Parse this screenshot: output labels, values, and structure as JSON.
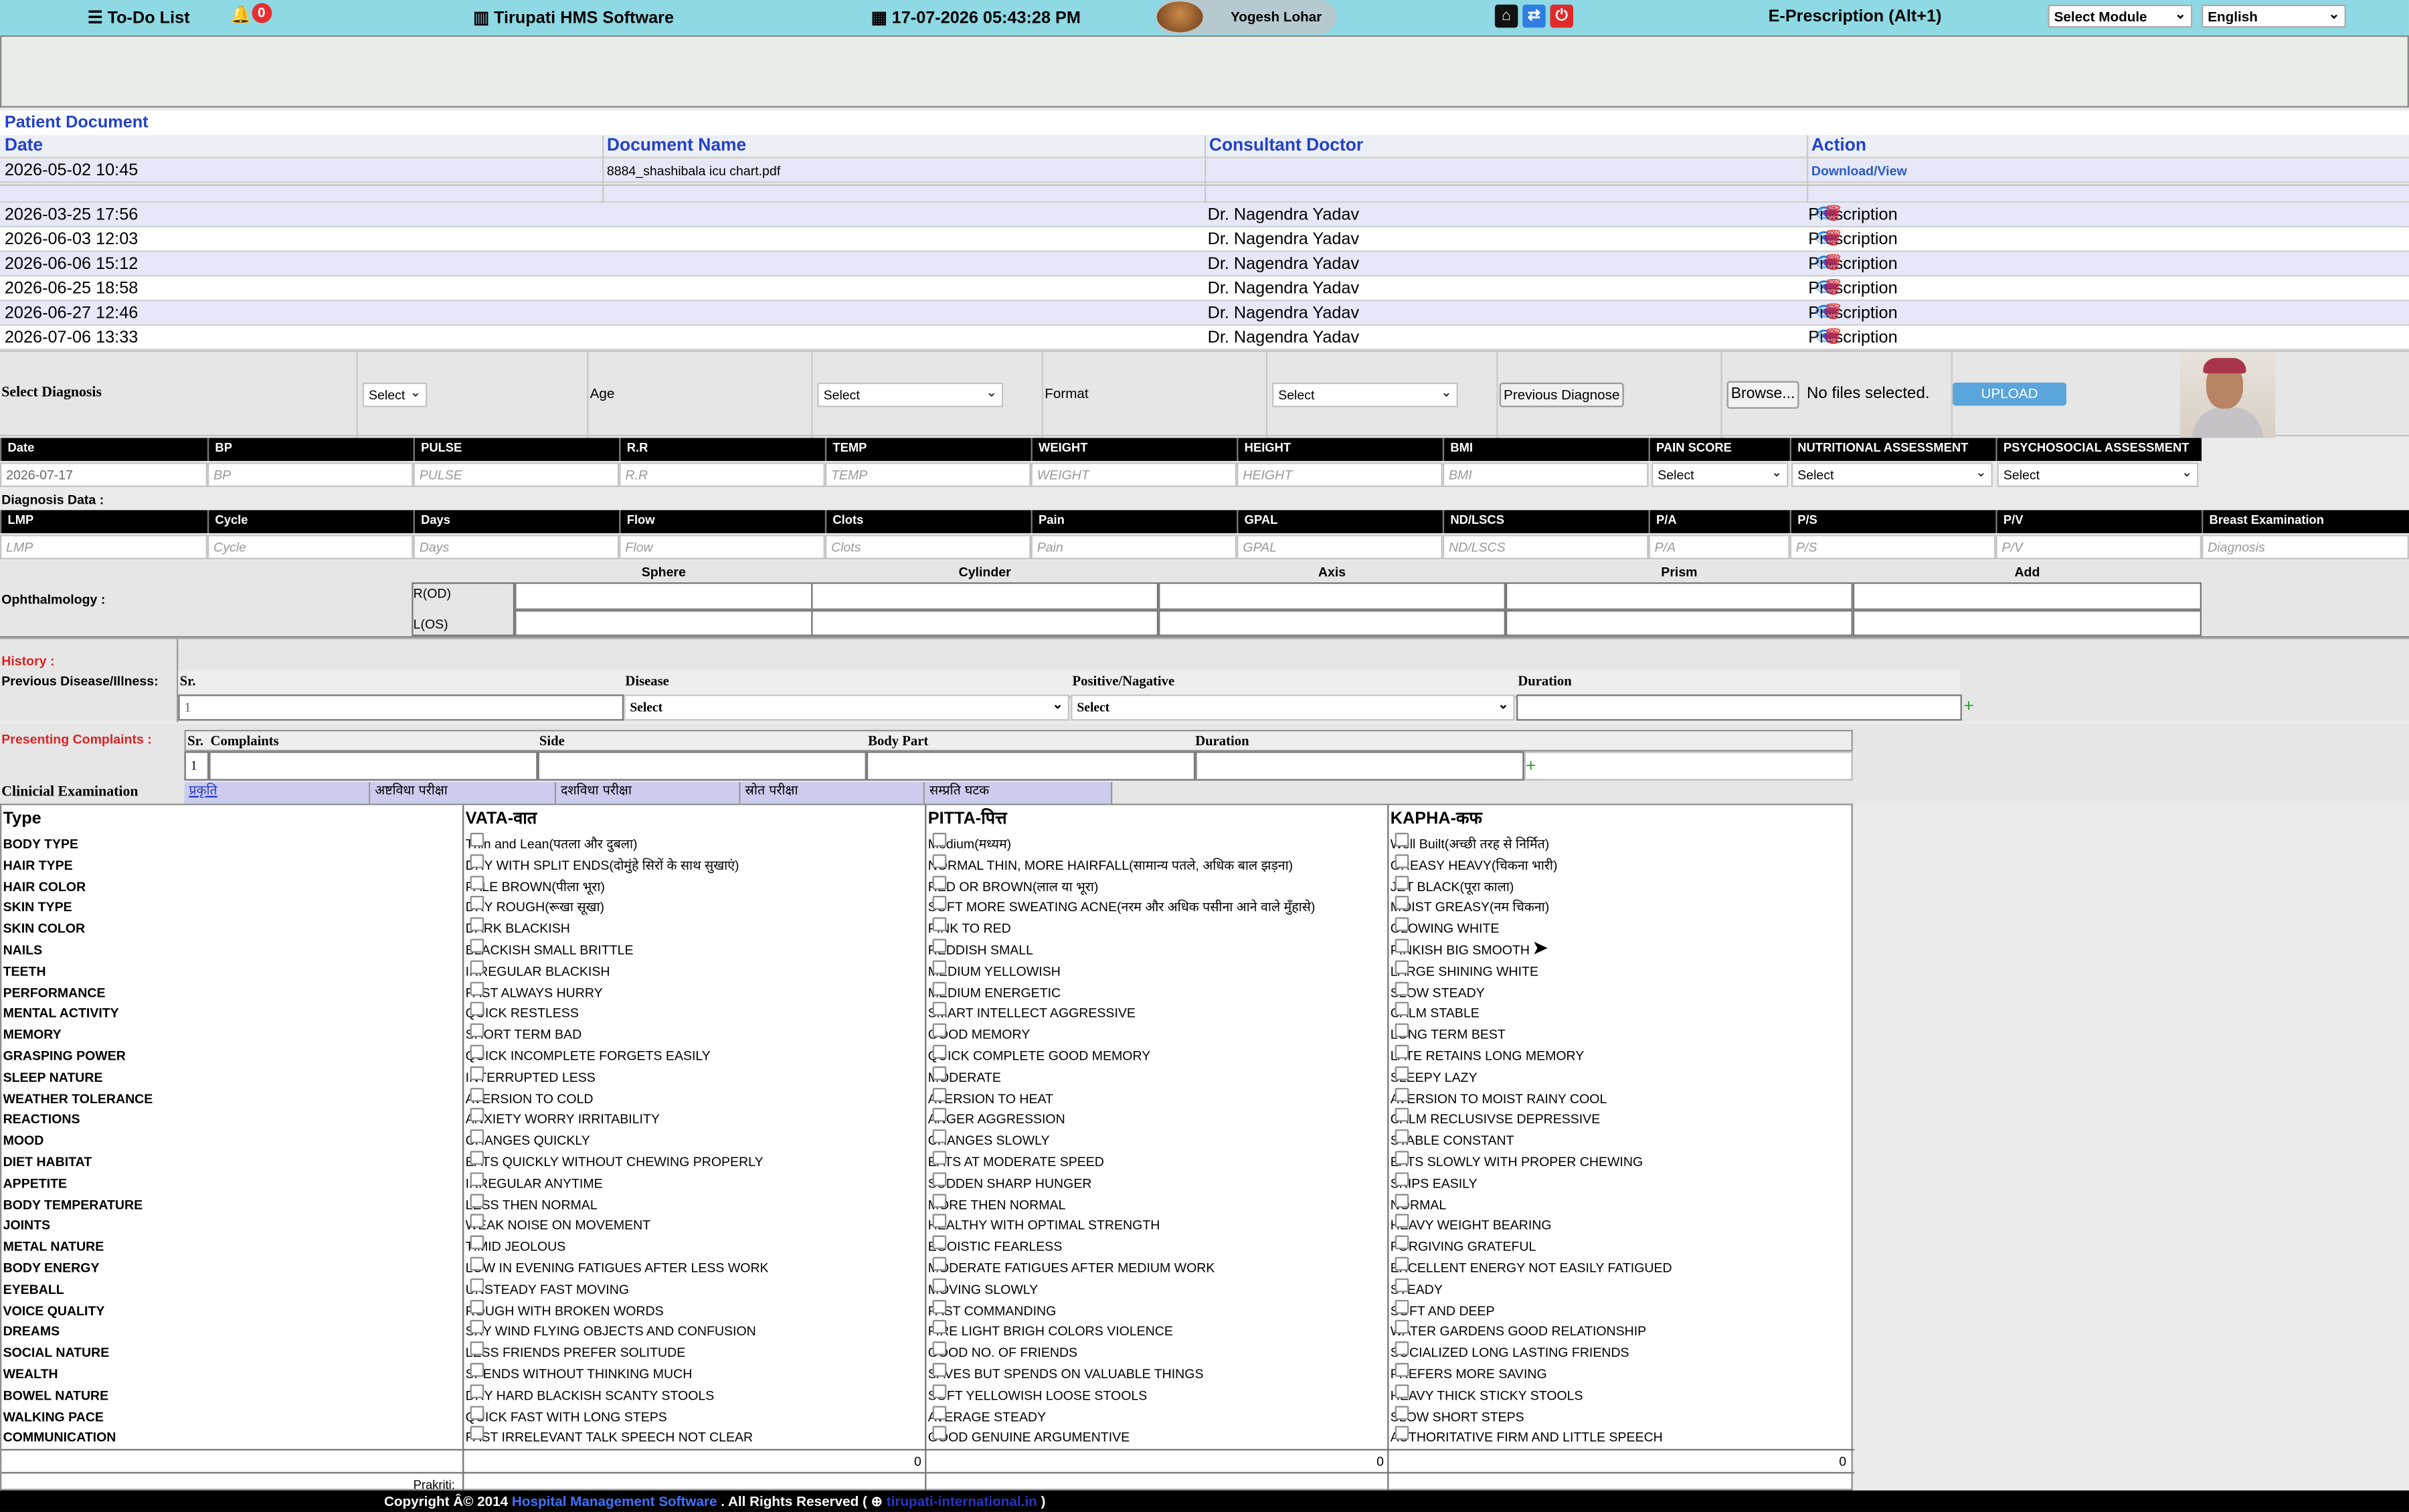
{
  "topbar": {
    "todo": "To-Do List",
    "notif_count": "0",
    "app_name": "Tirupati HMS Software",
    "datetime": "17-07-2026 05:43:28 PM",
    "user": "Yogesh Lohar",
    "eprescription": "E-Prescription (Alt+1)",
    "module_select": "Select Module",
    "language_select": "English"
  },
  "patient_document": {
    "title": "Patient Document",
    "headers": [
      "Date",
      "Document Name",
      "Consultant Doctor",
      "Action"
    ],
    "documents": [
      {
        "date": "2026-05-02 10:45",
        "name": "8884_shashibala icu chart.pdf",
        "doctor": "",
        "action": "Download/View"
      }
    ],
    "prescriptions": [
      {
        "date": "2026-03-25 17:56",
        "doctor": "Dr. Nagendra Yadav",
        "action": "Prescription"
      },
      {
        "date": "2026-06-03 12:03",
        "doctor": "Dr. Nagendra Yadav",
        "action": "Prescription"
      },
      {
        "date": "2026-06-06 15:12",
        "doctor": "Dr. Nagendra Yadav",
        "action": "Prescription"
      },
      {
        "date": "2026-06-25 18:58",
        "doctor": "Dr. Nagendra Yadav",
        "action": "Prescription"
      },
      {
        "date": "2026-06-27 12:46",
        "doctor": "Dr. Nagendra Yadav",
        "action": "Prescription"
      },
      {
        "date": "2026-07-06 13:33",
        "doctor": "Dr. Nagendra Yadav",
        "action": "Prescription"
      }
    ]
  },
  "diagnosis": {
    "select_label": "Select Diagnosis",
    "select_value": "Select",
    "age_label": "Age",
    "age_value": "Select",
    "format_label": "Format",
    "format_value": "Select",
    "previous_button": "Previous Diagnose",
    "browse_button": "Browse...",
    "file_status": "No files selected.",
    "upload_button": "UPLOAD"
  },
  "vitals": {
    "headers": [
      "Date",
      "BP",
      "PULSE",
      "R.R",
      "TEMP",
      "WEIGHT",
      "HEIGHT",
      "BMI",
      "PAIN SCORE",
      "NUTRITIONAL ASSESSMENT",
      "PSYCHOSOCIAL ASSESSMENT"
    ],
    "date_value": "2026-07-17",
    "placeholders": [
      "BP",
      "PULSE",
      "R.R",
      "TEMP",
      "WEIGHT",
      "HEIGHT",
      "BMI"
    ],
    "select_value": "Select"
  },
  "diagnosis_data": {
    "label": "Diagnosis Data :",
    "headers": [
      "LMP",
      "Cycle",
      "Days",
      "Flow",
      "Clots",
      "Pain",
      "GPAL",
      "ND/LSCS",
      "P/A",
      "P/S",
      "P/V",
      "Breast Examination"
    ],
    "placeholders": [
      "LMP",
      "Cycle",
      "Days",
      "Flow",
      "Clots",
      "Pain",
      "GPAL",
      "ND/LSCS",
      "P/A",
      "P/S",
      "P/V",
      "Diagnosis"
    ]
  },
  "ophthalmology": {
    "label": "Ophthalmology :",
    "columns": [
      "Sphere",
      "Cylinder",
      "Axis",
      "Prism",
      "Add"
    ],
    "rows": [
      "R(OD)",
      "L(OS)"
    ]
  },
  "history": {
    "title": "History :",
    "previous_label": "Previous Disease/Illness:",
    "headers": [
      "Sr.",
      "Disease",
      "Positive/Nagative",
      "Duration"
    ],
    "row_sr": "1",
    "disease_select": "Select",
    "posneg_select": "Select"
  },
  "presenting": {
    "title": "Presenting Complaints :",
    "headers": [
      "Sr.",
      "Complaints",
      "Side",
      "Body Part",
      "Duration"
    ],
    "row_sr": "1"
  },
  "clinical": {
    "label": "Clinicial Examination",
    "tabs": [
      "प्रकृति",
      "अष्टविधा परीक्षा",
      "दशविधा परीक्षा",
      "स्रोत परीक्षा",
      "सम्प्रति घटक"
    ]
  },
  "prakriti": {
    "headers": [
      "Type",
      "VATA-वात",
      "PITTA-पित्त",
      "KAPHA-कफ"
    ],
    "rows": [
      [
        "BODY TYPE",
        "Thin and Lean(पतला और दुबला)",
        "Medium(मध्यम)",
        "Well Built(अच्छी तरह से निर्मित)"
      ],
      [
        "HAIR TYPE",
        "DRY WITH SPLIT ENDS(दोमुंहे सिरों के साथ सुखाएं)",
        "NORMAL THIN, MORE HAIRFALL(सामान्य पतले, अधिक बाल झड़ना)",
        "GREASY HEAVY(चिकना भारी)"
      ],
      [
        "HAIR COLOR",
        "PALE BROWN(पीला भूरा)",
        "RED OR BROWN(लाल या भूरा)",
        "JET BLACK(पूरा काला)"
      ],
      [
        "SKIN TYPE",
        "DRY ROUGH(रूखा सूखा)",
        "SOFT MORE SWEATING ACNE(नरम और अधिक पसीना आने वाले मुँहासे)",
        "MOIST GREASY(नम चिकना)"
      ],
      [
        "SKIN COLOR",
        "DARK BLACKISH",
        "PINK TO RED",
        "GLOWING WHITE"
      ],
      [
        "NAILS",
        "BLACKISH SMALL BRITTLE",
        "REDDISH SMALL",
        "PINKISH BIG SMOOTH"
      ],
      [
        "TEETH",
        "IRREGULAR BLACKISH",
        "MEDIUM YELLOWISH",
        "LARGE SHINING WHITE"
      ],
      [
        "PERFORMANCE",
        "FAST ALWAYS HURRY",
        "MEDIUM ENERGETIC",
        "SLOW STEADY"
      ],
      [
        "MENTAL ACTIVITY",
        "QUICK RESTLESS",
        "SMART INTELLECT AGGRESSIVE",
        "CALM STABLE"
      ],
      [
        "MEMORY",
        "SHORT TERM BAD",
        "GOOD MEMORY",
        "LONG TERM BEST"
      ],
      [
        "GRASPING POWER",
        "QUICK INCOMPLETE FORGETS EASILY",
        "QUICK COMPLETE GOOD MEMORY",
        "LATE RETAINS LONG MEMORY"
      ],
      [
        "SLEEP NATURE",
        "INTERRUPTED LESS",
        "MODERATE",
        "SLEEPY LAZY"
      ],
      [
        "WEATHER TOLERANCE",
        "AVERSION TO COLD",
        "AVERSION TO HEAT",
        "AVERSION TO MOIST RAINY COOL"
      ],
      [
        "REACTIONS",
        "ANXIETY WORRY IRRITABILITY",
        "ANGER AGGRESSION",
        "CALM RECLUSIVSE DEPRESSIVE"
      ],
      [
        "MOOD",
        "CHANGES QUICKLY",
        "CHANGES SLOWLY",
        "STABLE CONSTANT"
      ],
      [
        "DIET HABITAT",
        "EATS QUICKLY WITHOUT CHEWING PROPERLY",
        "EATS AT MODERATE SPEED",
        "EATS SLOWLY WITH PROPER CHEWING"
      ],
      [
        "APPETITE",
        "IRREGULAR ANYTIME",
        "SUDDEN SHARP HUNGER",
        "SKIPS EASILY"
      ],
      [
        "BODY TEMPERATURE",
        "LESS THEN NORMAL",
        "MORE THEN NORMAL",
        "NORMAL"
      ],
      [
        "JOINTS",
        "WEAK NOISE ON MOVEMENT",
        "HEALTHY WITH OPTIMAL STRENGTH",
        "HEAVY WEIGHT BEARING"
      ],
      [
        "METAL NATURE",
        "TIMID JEOLOUS",
        "EGOISTIC FEARLESS",
        "FORGIVING GRATEFUL"
      ],
      [
        "BODY ENERGY",
        "LOW IN EVENING FATIGUES AFTER LESS WORK",
        "MODERATE FATIGUES AFTER MEDIUM WORK",
        "EXCELLENT ENERGY NOT EASILY FATIGUED"
      ],
      [
        "EYEBALL",
        "UNSTEADY FAST MOVING",
        "MOVING SLOWLY",
        "STEADY"
      ],
      [
        "VOICE QUALITY",
        "ROUGH WITH BROKEN WORDS",
        "FAST COMMANDING",
        "SOFT AND DEEP"
      ],
      [
        "DREAMS",
        "SKY WIND FLYING OBJECTS AND CONFUSION",
        "FIRE LIGHT BRIGH COLORS VIOLENCE",
        "WATER GARDENS GOOD RELATIONSHIP"
      ],
      [
        "SOCIAL NATURE",
        "LESS FRIENDS PREFER SOLITUDE",
        "GOOD NO. OF FRIENDS",
        "SOCIALIZED LONG LASTING FRIENDS"
      ],
      [
        "WEALTH",
        "SPENDS WITHOUT THINKING MUCH",
        "SAVES BUT SPENDS ON VALUABLE THINGS",
        "PREFERS MORE SAVING"
      ],
      [
        "BOWEL NATURE",
        "DRY HARD BLACKISH SCANTY STOOLS",
        "SOFT YELLOWISH LOOSE STOOLS",
        "HEAVY THICK STICKY STOOLS"
      ],
      [
        "WALKING PACE",
        "QUICK FAST WITH LONG STEPS",
        "AVERAGE STEADY",
        "SLOW SHORT STEPS"
      ],
      [
        "COMMUNICATION",
        "FAST IRRELEVANT TALK SPEECH NOT CLEAR",
        "GOOD GENUINE ARGUMENTIVE",
        "AUTHORITATIVE FIRM AND LITTLE SPEECH"
      ]
    ],
    "totals": [
      "0",
      "0",
      "0"
    ],
    "prakriti_label": "Prakriti:"
  },
  "footer": {
    "prefix": "Copyright Â© 2014",
    "link": "Hospital Management Software",
    "suffix": ". All Rights Reserved (",
    "site": "tirupati-international.in",
    "end": ")"
  },
  "colors": {
    "topbar": "#8ed9e3",
    "link_blue": "#2341c9",
    "upload": "#5aa5dc",
    "tab": "#ccccef",
    "history_red": "#d62424"
  }
}
